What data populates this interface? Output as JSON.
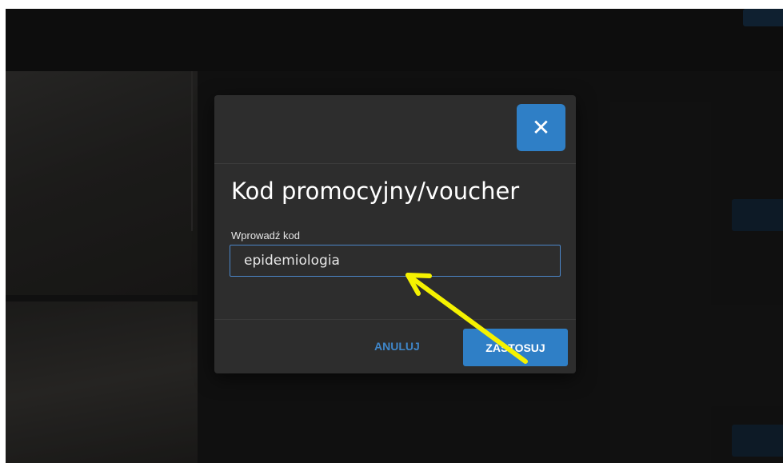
{
  "modal": {
    "close_symbol": "✕",
    "title": "Kod promocyjny/voucher",
    "field_label": "Wprowadź kod",
    "input_value": "epidemiologia",
    "cancel_label": "ANULUJ",
    "apply_label": "ZASTOSUJ"
  },
  "icons": {
    "close": "close-icon",
    "annotation": "arrow-icon"
  },
  "colors": {
    "accent": "#2f7fc6",
    "modal_bg": "#2d2d2d",
    "annotation": "#f5f200"
  }
}
